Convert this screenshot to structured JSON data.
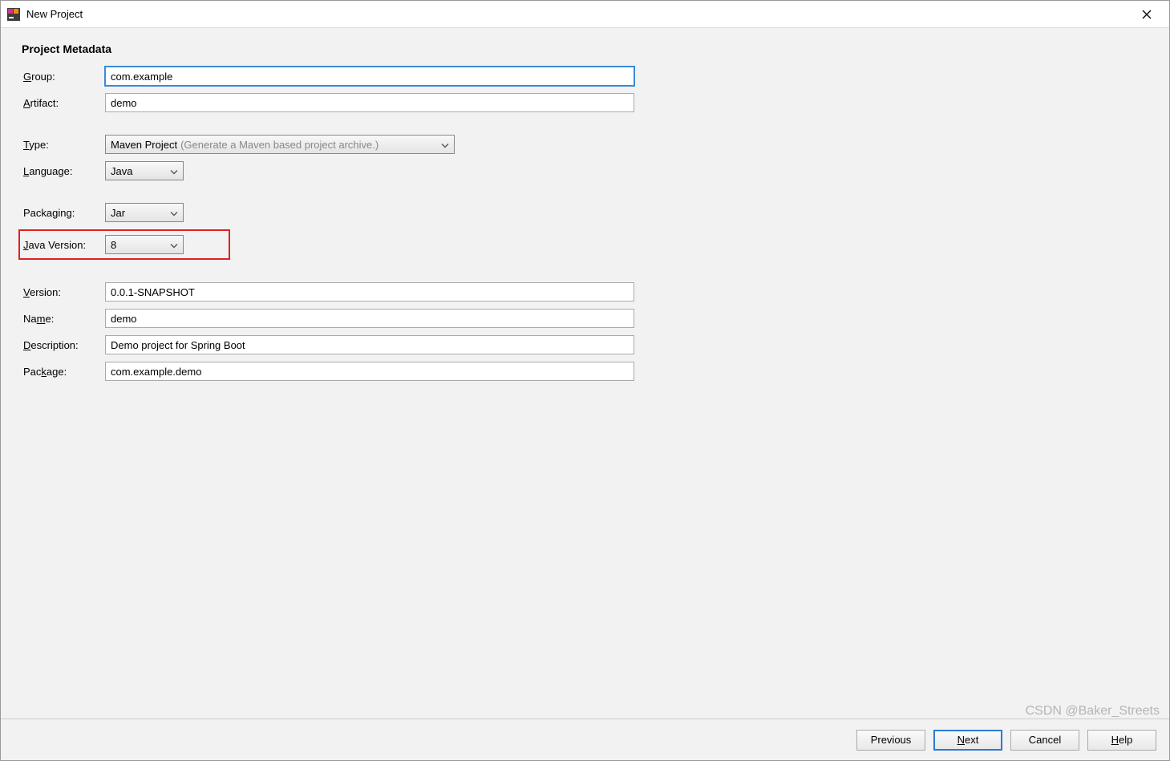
{
  "window": {
    "title": "New Project"
  },
  "section": {
    "title": "Project Metadata"
  },
  "labels": {
    "group_u": "G",
    "group_rest": "roup:",
    "artifact_u": "A",
    "artifact_rest": "rtifact:",
    "type_u": "T",
    "type_rest": "ype:",
    "language_u": "L",
    "language_rest": "anguage:",
    "packaging_u": "",
    "packaging_rest": "Packaging:",
    "javaversion_u": "J",
    "javaversion_rest": "ava Version:",
    "version_u": "V",
    "version_rest": "ersion:",
    "name_pre": "Na",
    "name_u": "m",
    "name_rest": "e:",
    "description_u": "D",
    "description_rest": "escription:",
    "package_pre": "Pac",
    "package_u": "k",
    "package_rest": "age:"
  },
  "fields": {
    "group": "com.example",
    "artifact": "demo",
    "type_value": "Maven Project",
    "type_hint": "(Generate a Maven based project archive.)",
    "language": "Java",
    "packaging": "Jar",
    "java_version": "8",
    "version": "0.0.1-SNAPSHOT",
    "name": "demo",
    "description": "Demo project for Spring Boot",
    "package": "com.example.demo"
  },
  "buttons": {
    "previous": "Previous",
    "next_u": "N",
    "next_rest": "ext",
    "cancel": "Cancel",
    "help_u": "H",
    "help_rest": "elp"
  },
  "watermark": "CSDN @Baker_Streets"
}
